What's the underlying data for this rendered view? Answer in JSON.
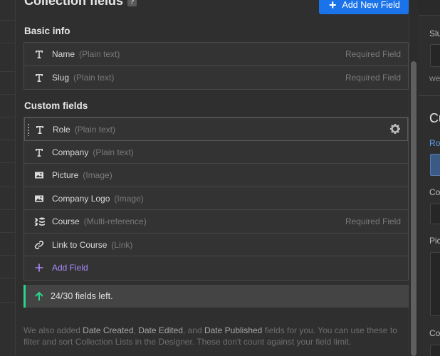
{
  "header": {
    "title": "Collection fields",
    "help_label": "?",
    "add_new_label": "Add New Field"
  },
  "basic_info": {
    "heading": "Basic info",
    "rows": [
      {
        "icon": "text-icon",
        "name": "Name",
        "type": "(Plain text)",
        "required": "Required Field"
      },
      {
        "icon": "text-icon",
        "name": "Slug",
        "type": "(Plain text)",
        "required": "Required Field"
      }
    ]
  },
  "custom_fields": {
    "heading": "Custom fields",
    "rows": [
      {
        "icon": "text-icon",
        "name": "Role",
        "type": "(Plain text)",
        "required": ""
      },
      {
        "icon": "text-icon",
        "name": "Company",
        "type": "(Plain text)",
        "required": ""
      },
      {
        "icon": "image-icon",
        "name": "Picture",
        "type": "(Image)",
        "required": ""
      },
      {
        "icon": "image-icon",
        "name": "Company Logo",
        "type": "(Image)",
        "required": ""
      },
      {
        "icon": "multi-reference-icon",
        "name": "Course",
        "type": "(Multi-reference)",
        "required": "Required Field"
      },
      {
        "icon": "link-icon",
        "name": "Link to Course",
        "type": "(Link)",
        "required": ""
      }
    ],
    "add_field_label": "Add Field"
  },
  "status": {
    "text": "24/30 fields left.",
    "accent": "#2bd48a"
  },
  "footnote": {
    "p1": "We also added ",
    "date_created": "Date Created",
    "sep1": ", ",
    "date_edited": "Date Edited",
    "sep2": ", and ",
    "date_published": "Date Published",
    "p2": " fields for you. You can use these to filter and sort Collection Lists in the Designer. These don't count against your field limit."
  },
  "right_pane": {
    "slug_label": "Slu",
    "we_text": "we",
    "heading": "Cu",
    "role_label": "Ro",
    "co_label": "Co",
    "pic_label": "Pic",
    "co2_label": "Co"
  },
  "colors": {
    "accent_blue": "#1a73e8",
    "accent_purple": "#a78bfa",
    "accent_green": "#2bd48a"
  }
}
